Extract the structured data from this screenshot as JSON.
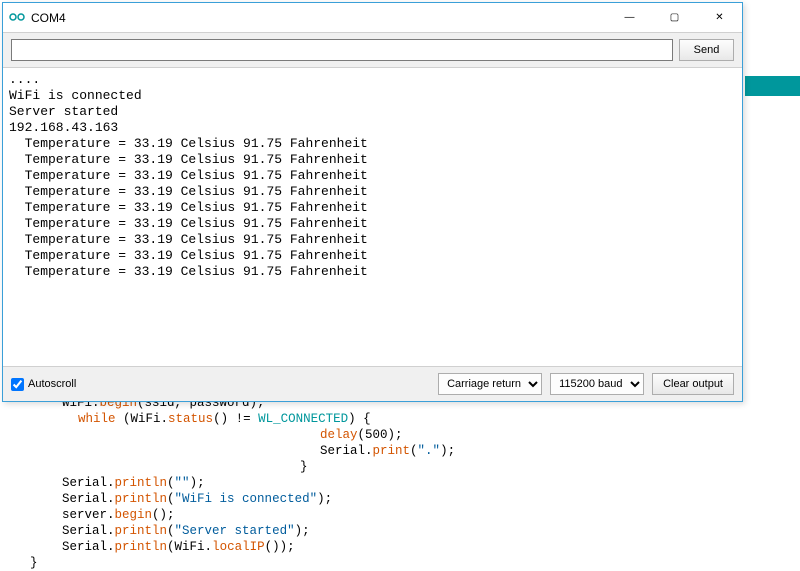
{
  "window": {
    "title": "COM4",
    "minimize": "—",
    "maximize": "▢",
    "close": "✕"
  },
  "inputbar": {
    "input_value": "",
    "input_placeholder": "",
    "send_label": "Send"
  },
  "console": {
    "lines": [
      "....",
      "WiFi is connected",
      "Server started",
      "192.168.43.163",
      "  Temperature = 33.19 Celsius 91.75 Fahrenheit",
      "  Temperature = 33.19 Celsius 91.75 Fahrenheit",
      "  Temperature = 33.19 Celsius 91.75 Fahrenheit",
      "  Temperature = 33.19 Celsius 91.75 Fahrenheit",
      "  Temperature = 33.19 Celsius 91.75 Fahrenheit",
      "  Temperature = 33.19 Celsius 91.75 Fahrenheit",
      "  Temperature = 33.19 Celsius 91.75 Fahrenheit",
      "  Temperature = 33.19 Celsius 91.75 Fahrenheit",
      "  Temperature = 33.19 Celsius 91.75 Fahrenheit"
    ]
  },
  "bottombar": {
    "autoscroll_label": "Autoscroll",
    "autoscroll_checked": true,
    "line_ending_selected": "Carriage return",
    "baud_selected": "115200 baud",
    "clear_label": "Clear output"
  },
  "code": {
    "tokens": [
      [
        [
          "var ind1",
          "WiFi."
        ],
        [
          "fn",
          "begin"
        ],
        [
          "punct",
          "(ssid, password);"
        ]
      ],
      [
        [
          "ind2",
          ""
        ],
        [
          "kw",
          "while"
        ],
        [
          "punct",
          " ("
        ],
        [
          "var",
          "WiFi."
        ],
        [
          "fn",
          "status"
        ],
        [
          "punct",
          "() != "
        ],
        [
          "lit",
          "WL_CONNECTED"
        ],
        [
          "punct",
          ") {"
        ]
      ],
      [
        [
          "ind-deep",
          ""
        ],
        [
          "fn",
          "delay"
        ],
        [
          "punct",
          "(500);"
        ]
      ],
      [
        [
          "ind-deep",
          ""
        ],
        [
          "var",
          "Serial."
        ],
        [
          "fn",
          "print"
        ],
        [
          "punct",
          "("
        ],
        [
          "str",
          "\".\""
        ],
        [
          "punct",
          ");"
        ]
      ],
      [
        [
          "ind-brace",
          ""
        ],
        [
          "punct",
          "}"
        ]
      ],
      [
        [
          "ind1",
          ""
        ],
        [
          "var",
          "Serial."
        ],
        [
          "fn",
          "println"
        ],
        [
          "punct",
          "("
        ],
        [
          "str",
          "\"\""
        ],
        [
          "punct",
          ");"
        ]
      ],
      [
        [
          "ind1",
          ""
        ],
        [
          "var",
          "Serial."
        ],
        [
          "fn",
          "println"
        ],
        [
          "punct",
          "("
        ],
        [
          "str",
          "\"WiFi is connected\""
        ],
        [
          "punct",
          ");"
        ]
      ],
      [
        [
          "ind1",
          ""
        ],
        [
          "var",
          "server."
        ],
        [
          "fn",
          "begin"
        ],
        [
          "punct",
          "();"
        ]
      ],
      [
        [
          "ind1",
          ""
        ],
        [
          "var",
          "Serial."
        ],
        [
          "fn",
          "println"
        ],
        [
          "punct",
          "("
        ],
        [
          "str",
          "\"Server started\""
        ],
        [
          "punct",
          ");"
        ]
      ],
      [
        [
          "ind1",
          ""
        ],
        [
          "var",
          "Serial."
        ],
        [
          "fn",
          "println"
        ],
        [
          "punct",
          "("
        ],
        [
          "var",
          "WiFi."
        ],
        [
          "fn",
          "localIP"
        ],
        [
          "punct",
          "());"
        ]
      ],
      [
        [
          "punct",
          "}"
        ]
      ]
    ]
  }
}
